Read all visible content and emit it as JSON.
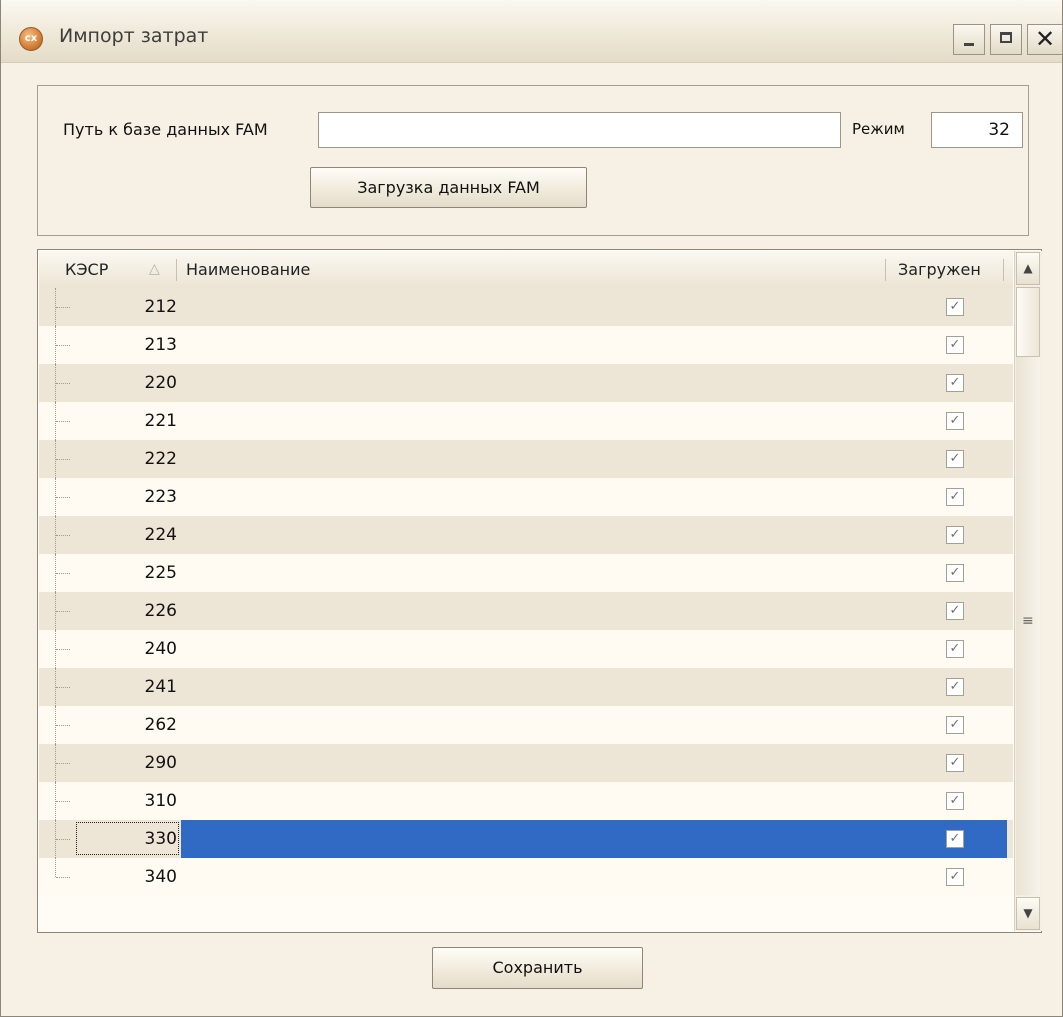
{
  "window": {
    "title": "Импорт затрат",
    "app_icon": "cx-app-icon"
  },
  "form": {
    "path_label": "Путь к базе данных FAM",
    "path_value": "",
    "mode_label": "Режим",
    "mode_value": "32",
    "load_button": "Загрузка данных FAM",
    "save_button": "Сохранить"
  },
  "grid": {
    "columns": [
      "КЭСР",
      "Наименование",
      "Загружен"
    ],
    "sort_indicator": "△",
    "rows": [
      {
        "code": "212",
        "name": "",
        "loaded": true
      },
      {
        "code": "213",
        "name": "",
        "loaded": true
      },
      {
        "code": "220",
        "name": "",
        "loaded": true
      },
      {
        "code": "221",
        "name": "",
        "loaded": true
      },
      {
        "code": "222",
        "name": "",
        "loaded": true
      },
      {
        "code": "223",
        "name": "",
        "loaded": true
      },
      {
        "code": "224",
        "name": "",
        "loaded": true
      },
      {
        "code": "225",
        "name": "",
        "loaded": true
      },
      {
        "code": "226",
        "name": "",
        "loaded": true
      },
      {
        "code": "240",
        "name": "",
        "loaded": true
      },
      {
        "code": "241",
        "name": "",
        "loaded": true
      },
      {
        "code": "262",
        "name": "",
        "loaded": true
      },
      {
        "code": "290",
        "name": "",
        "loaded": true
      },
      {
        "code": "310",
        "name": "",
        "loaded": true
      },
      {
        "code": "330",
        "name": "",
        "loaded": true,
        "selected": true
      },
      {
        "code": "340",
        "name": "",
        "loaded": true
      }
    ]
  },
  "colors": {
    "background": "#f6f1e4",
    "row_alt": "#ede6d6",
    "selection": "#316ac5"
  }
}
